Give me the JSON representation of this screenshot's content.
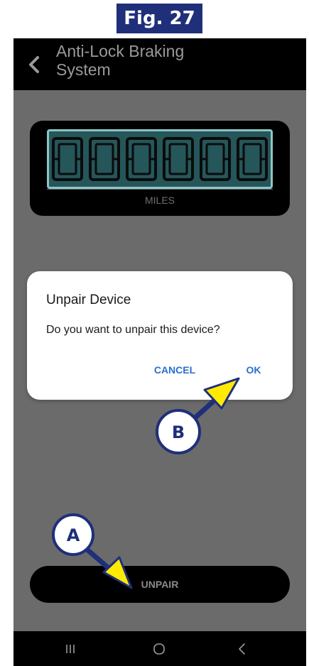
{
  "figure": {
    "label": "Fig. 27"
  },
  "header": {
    "title_line1": "Anti-Lock Braking",
    "title_line2": "System"
  },
  "odometer": {
    "digits": "000000",
    "unit": "MILES"
  },
  "dialog": {
    "title": "Unpair Device",
    "message": "Do you want to unpair this device?",
    "cancel_label": "CANCEL",
    "ok_label": "OK"
  },
  "main": {
    "unpair_label": "UNPAIR"
  },
  "callouts": {
    "a": "A",
    "b": "B"
  },
  "colors": {
    "figure_badge": "#1f2f7a",
    "screen_overlay": "#6b6b6b",
    "lcd_background": "#25565a",
    "dialog_action": "#2a6fd0",
    "callout_arrow": "#ffea00"
  },
  "icons": {
    "back": "chevron-left-icon",
    "recent_apps": "recent-apps-icon",
    "home": "home-icon",
    "nav_back": "nav-back-icon"
  }
}
